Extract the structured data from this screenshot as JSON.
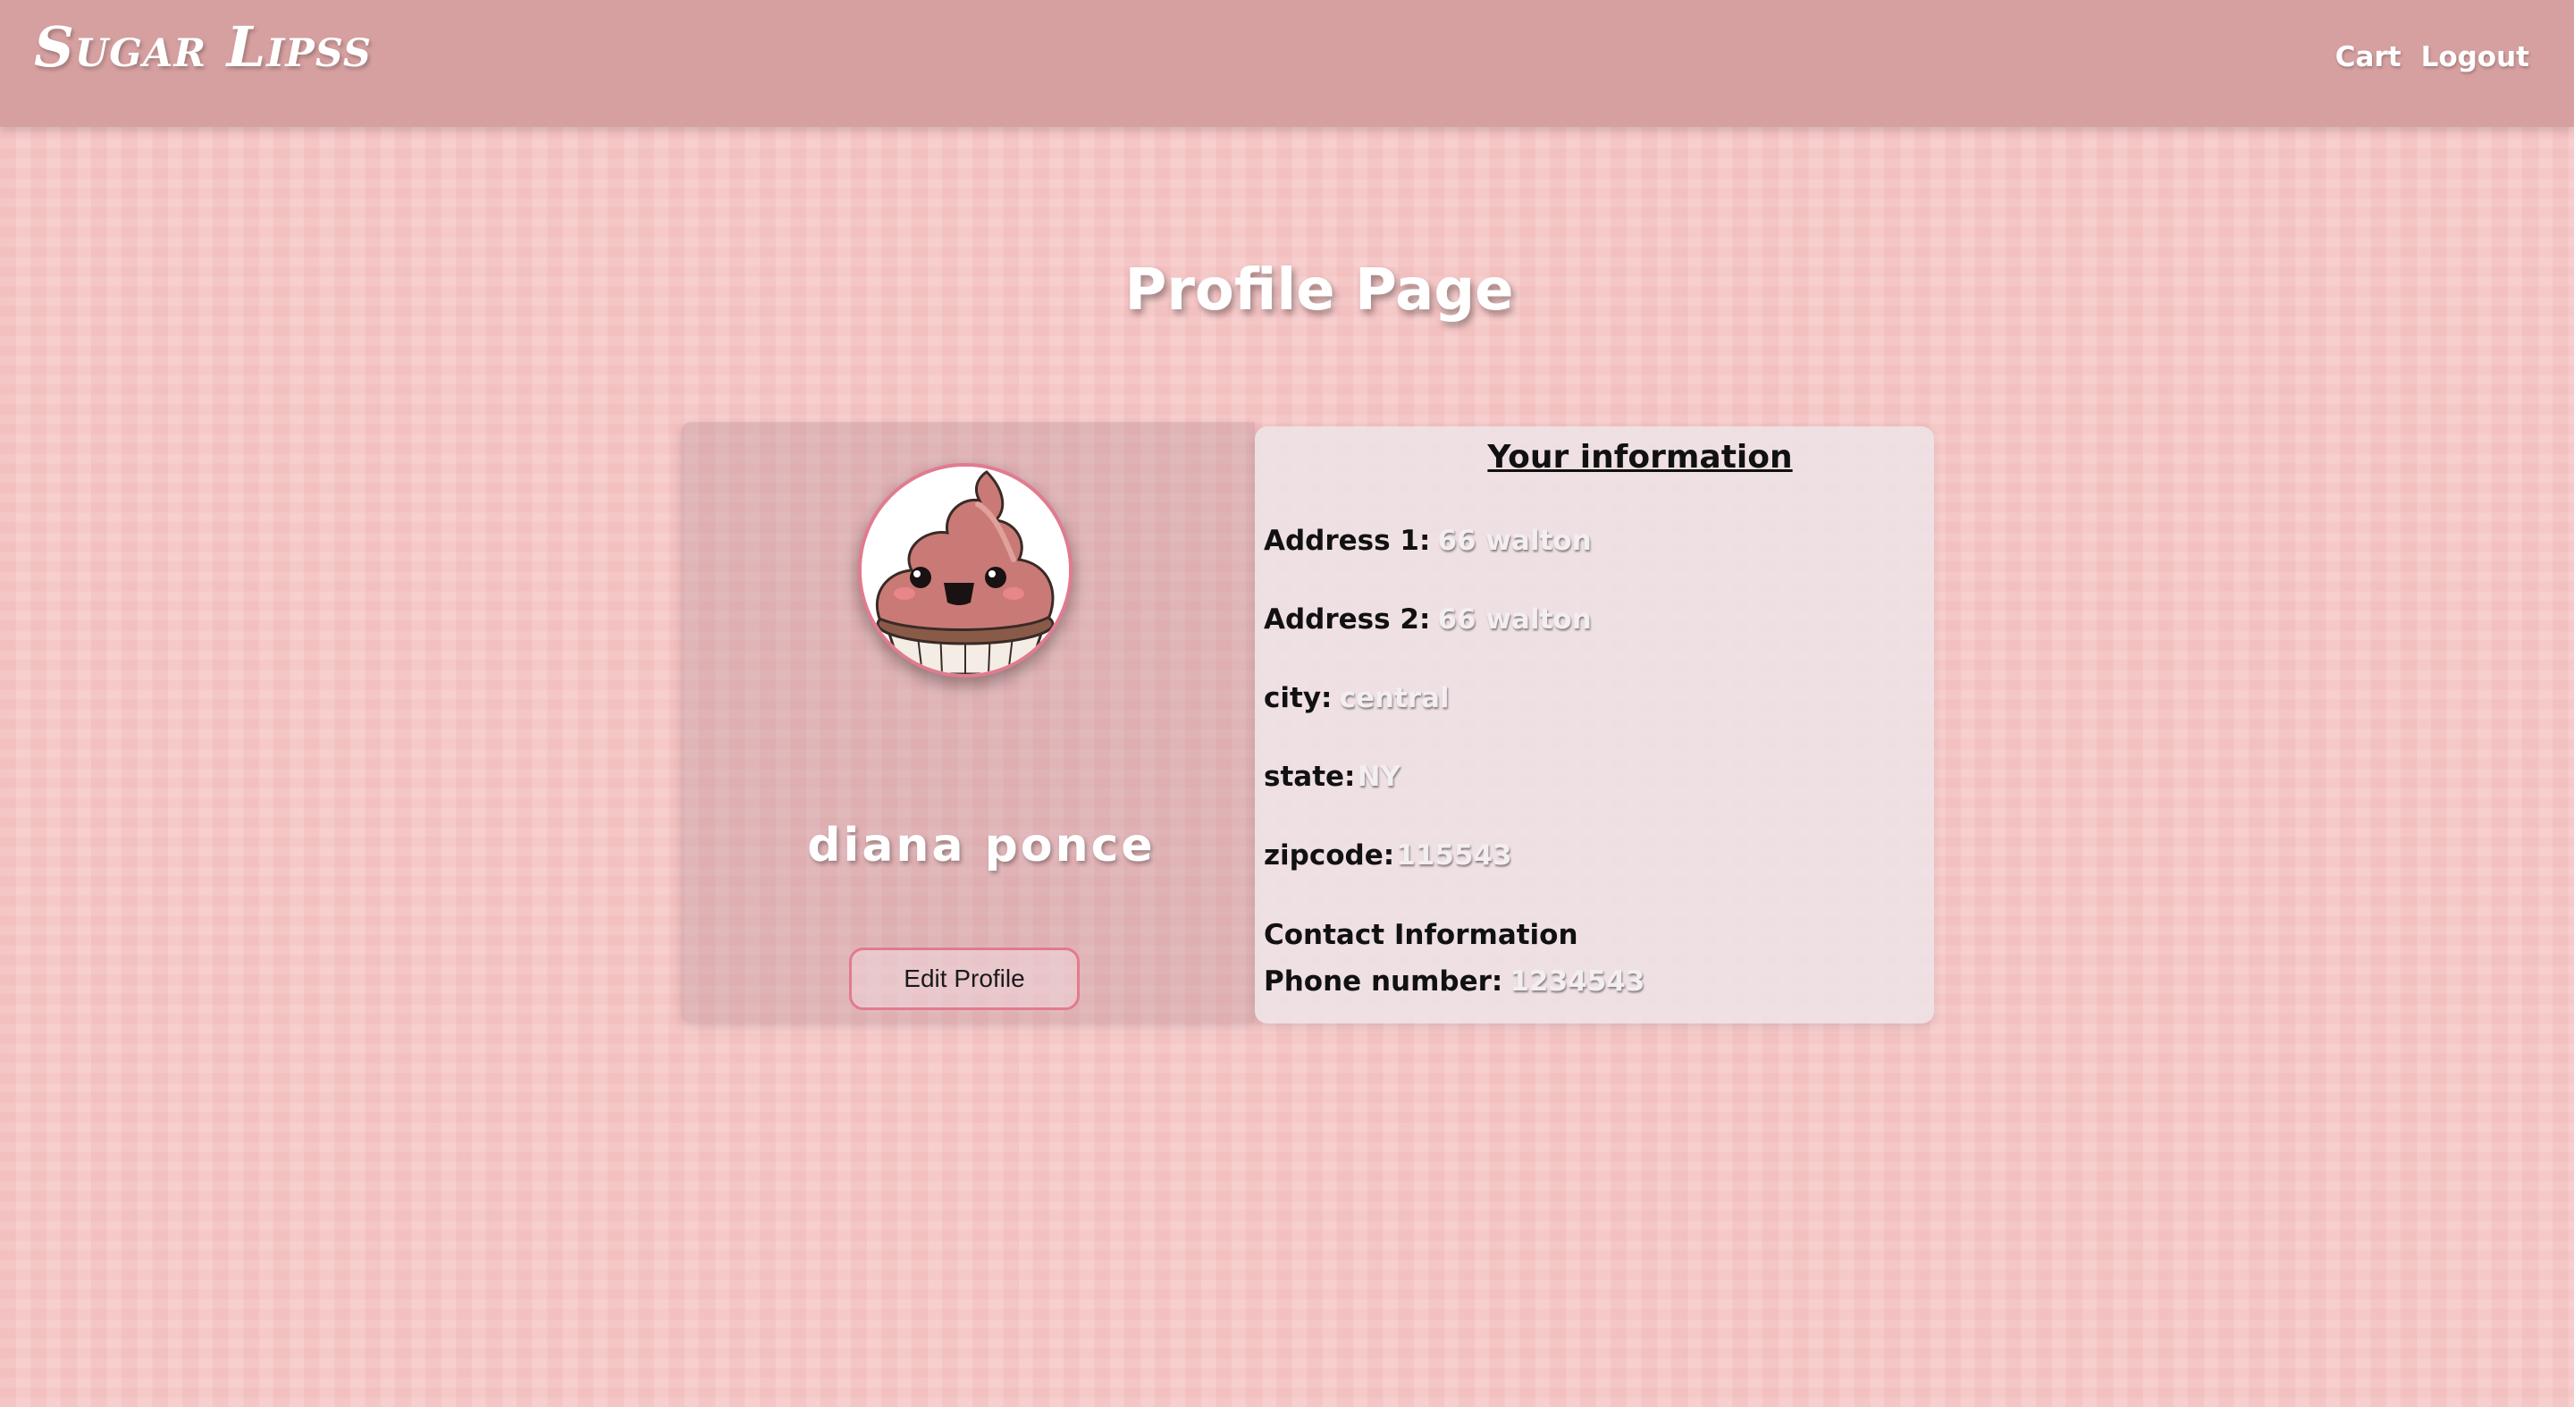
{
  "header": {
    "brand": "Sugar Lipss",
    "nav": {
      "cart": "Cart",
      "logout": "Logout"
    }
  },
  "page": {
    "title": "Profile Page"
  },
  "profile": {
    "avatar_icon": "cupcake-avatar-icon",
    "name": "diana ponce",
    "edit_button": "Edit Profile"
  },
  "info": {
    "title": "Your information",
    "address1": {
      "label": "Address 1:",
      "value": "66 walton"
    },
    "address2": {
      "label": "Address 2:",
      "value": "66 walton"
    },
    "city": {
      "label": "city:",
      "value": "central"
    },
    "state": {
      "label": "state:",
      "value": "NY"
    },
    "zipcode": {
      "label": "zipcode:",
      "value": "115543"
    },
    "contact_heading": "Contact Information",
    "phone": {
      "label": "Phone number:",
      "value": "1234543"
    }
  },
  "colors": {
    "header_bg": "#d6a0a0",
    "page_bg": "#f6c9c9",
    "accent_border": "#e27a90",
    "card_bg": "#eee2e6"
  }
}
